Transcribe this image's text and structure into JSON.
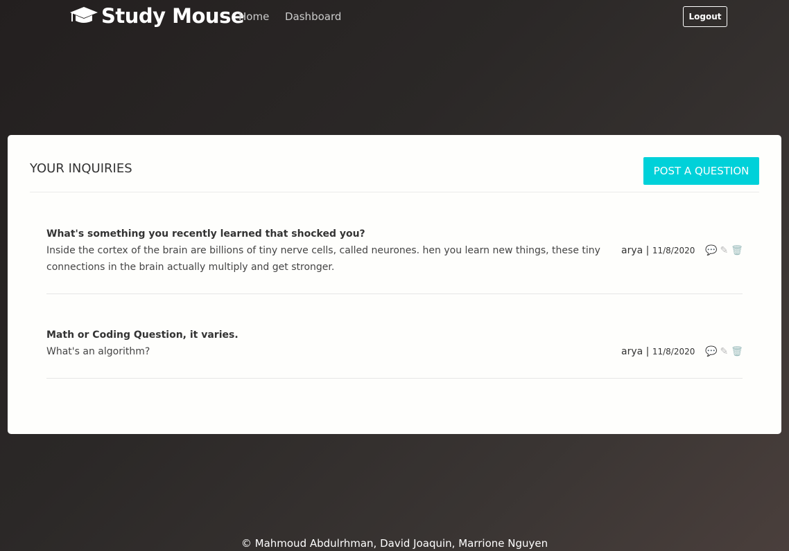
{
  "nav": {
    "brand": "Study Mouse",
    "home": "Home",
    "dashboard": "Dashboard",
    "logout": "Logout"
  },
  "main": {
    "title": "YOUR INQUIRIES",
    "post_button": "POST A QUESTION",
    "questions": [
      {
        "title": "What's something you recently learned that shocked you?",
        "body": "Inside the cortex of the brain are billions of tiny nerve cells, called neurones. hen you learn new things, these tiny connections in the brain actually multiply and get stronger.",
        "author": "arya",
        "date": "11/8/2020"
      },
      {
        "title": "Math or Coding Question, it varies.",
        "body": "What's an algorithm?",
        "author": "arya",
        "date": "11/8/2020"
      }
    ]
  },
  "footer": "© Mahmoud Abdulrhman, David Joaquin, Marrione Nguyen",
  "colors": {
    "accent": "#00d1d9"
  }
}
